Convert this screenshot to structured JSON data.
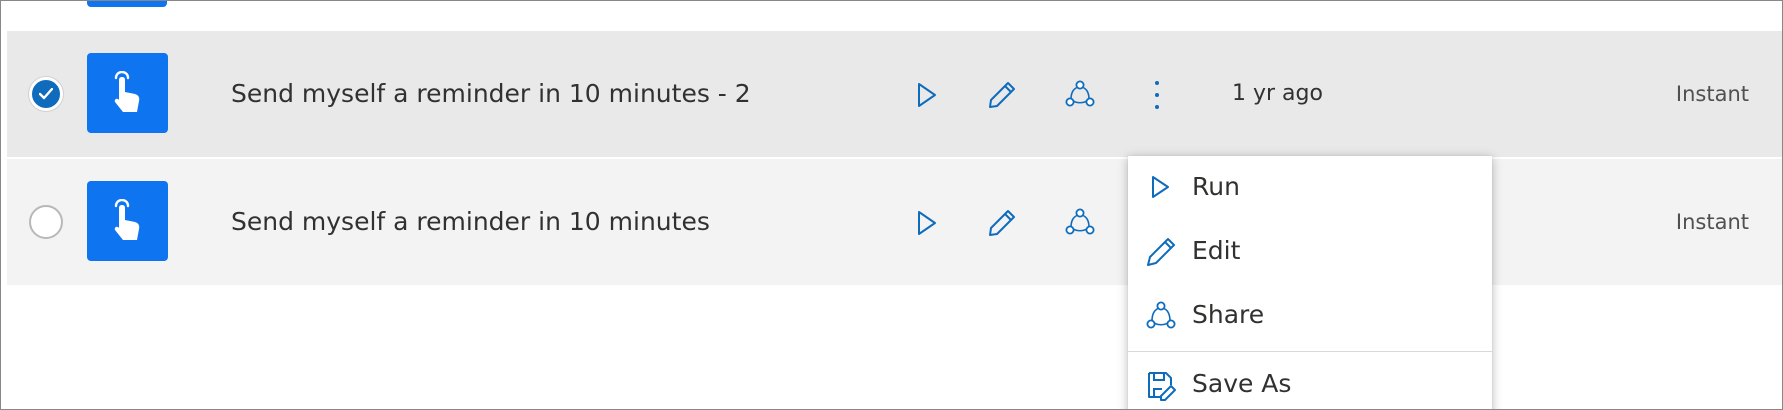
{
  "flows": [
    {
      "selected": true,
      "name": "Send myself a reminder in 10 minutes - 2",
      "modified": "1 yr ago",
      "type": "Instant",
      "icon": "touch-icon"
    },
    {
      "selected": false,
      "name": "Send myself a reminder in 10 minutes",
      "modified": "",
      "type": "Instant",
      "icon": "touch-icon"
    }
  ],
  "row_actions": {
    "run_icon": "play-icon",
    "edit_icon": "pencil-icon",
    "share_icon": "share-icon",
    "more_icon": "more-vertical-icon"
  },
  "context_menu": {
    "items": [
      {
        "label": "Run",
        "icon": "play-icon"
      },
      {
        "label": "Edit",
        "icon": "pencil-icon"
      },
      {
        "label": "Share",
        "icon": "share-icon"
      },
      {
        "label": "Save As",
        "icon": "save-as-icon"
      }
    ]
  },
  "colors": {
    "accent": "#0f6cbd",
    "tile": "#0f74f0",
    "selected_row": "#e9e9e9",
    "row": "#f3f3f3",
    "text": "#323130"
  }
}
